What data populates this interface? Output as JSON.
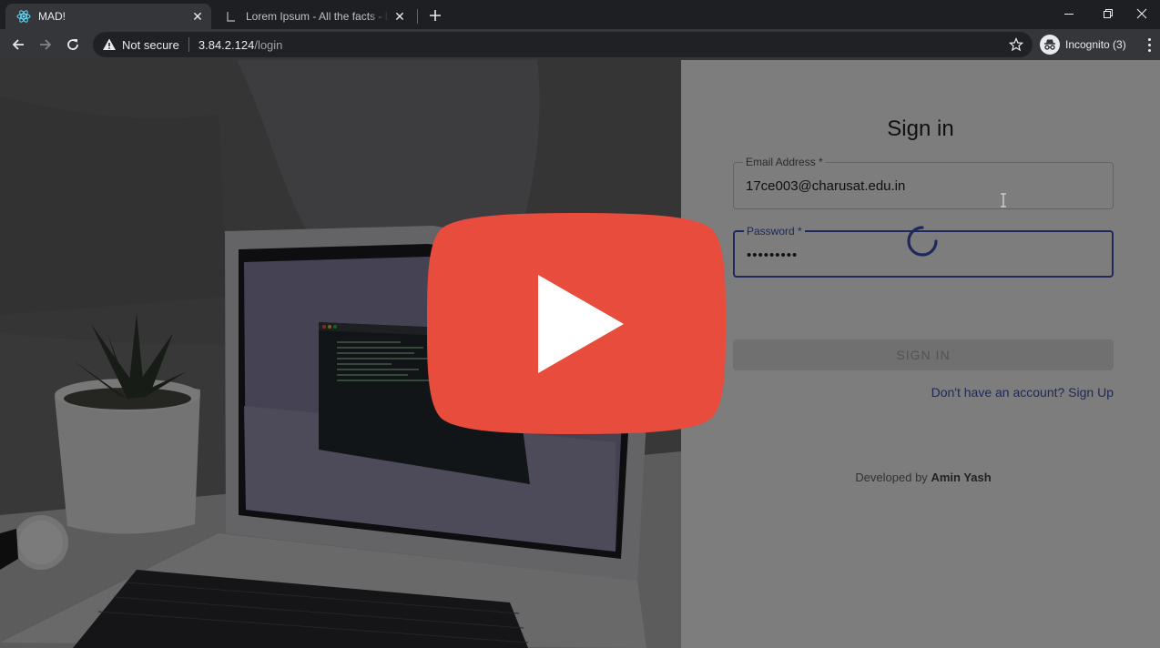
{
  "browser": {
    "tabs": [
      {
        "title": "MAD!",
        "icon": "react-icon",
        "active": true
      },
      {
        "title": "Lorem Ipsum - All the facts - Lipsum generator",
        "icon": "lipsum-icon",
        "active": false
      }
    ],
    "address": {
      "security": "Not secure",
      "host": "3.84.2.124",
      "path": "/login"
    },
    "incognito_label": "Incognito (3)"
  },
  "login": {
    "title": "Sign in",
    "email": {
      "label": "Email Address *",
      "value": "17ce003@charusat.edu.in"
    },
    "password": {
      "label": "Password *",
      "value": "•••••••••"
    },
    "submit_label": "SIGN IN",
    "signup_link": "Don't have an account? Sign Up",
    "footer_prefix": "Developed by",
    "footer_author": "Amin Yash"
  },
  "colors": {
    "accent": "#3f51b5",
    "play_button": "#e84c3d",
    "chrome_bg": "#35363a"
  }
}
